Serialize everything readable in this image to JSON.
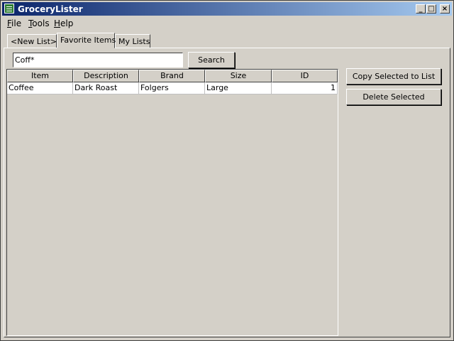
{
  "window": {
    "title": "GroceryLister",
    "controls": {
      "minimize": "_",
      "maximize": "□",
      "close": "×"
    }
  },
  "menu": {
    "items": [
      {
        "key": "F",
        "rest": "ile"
      },
      {
        "key": "T",
        "rest": "ools"
      },
      {
        "key": "H",
        "rest": "elp"
      }
    ]
  },
  "tabs": [
    {
      "label": "<New List>*",
      "active": false
    },
    {
      "label": "Favorite Items",
      "active": true
    },
    {
      "label": "My Lists",
      "active": false
    }
  ],
  "search": {
    "value": "Coff*",
    "button_label": "Search"
  },
  "table": {
    "columns": [
      "Item",
      "Description",
      "Brand",
      "Size",
      "ID"
    ],
    "rows": [
      [
        "Coffee",
        "Dark Roast",
        "Folgers",
        "Large",
        "1"
      ]
    ]
  },
  "actions": {
    "copy_label": "Copy Selected to List",
    "delete_label": "Delete Selected"
  },
  "colors": {
    "title_start": "#0a246a",
    "title_end": "#a6caf0",
    "face": "#d4d0c8",
    "icon": "#2e7d32"
  },
  "icons": {
    "app": "grocery-list-icon",
    "minimize": "minimize-icon",
    "maximize": "maximize-icon",
    "close": "close-icon"
  }
}
